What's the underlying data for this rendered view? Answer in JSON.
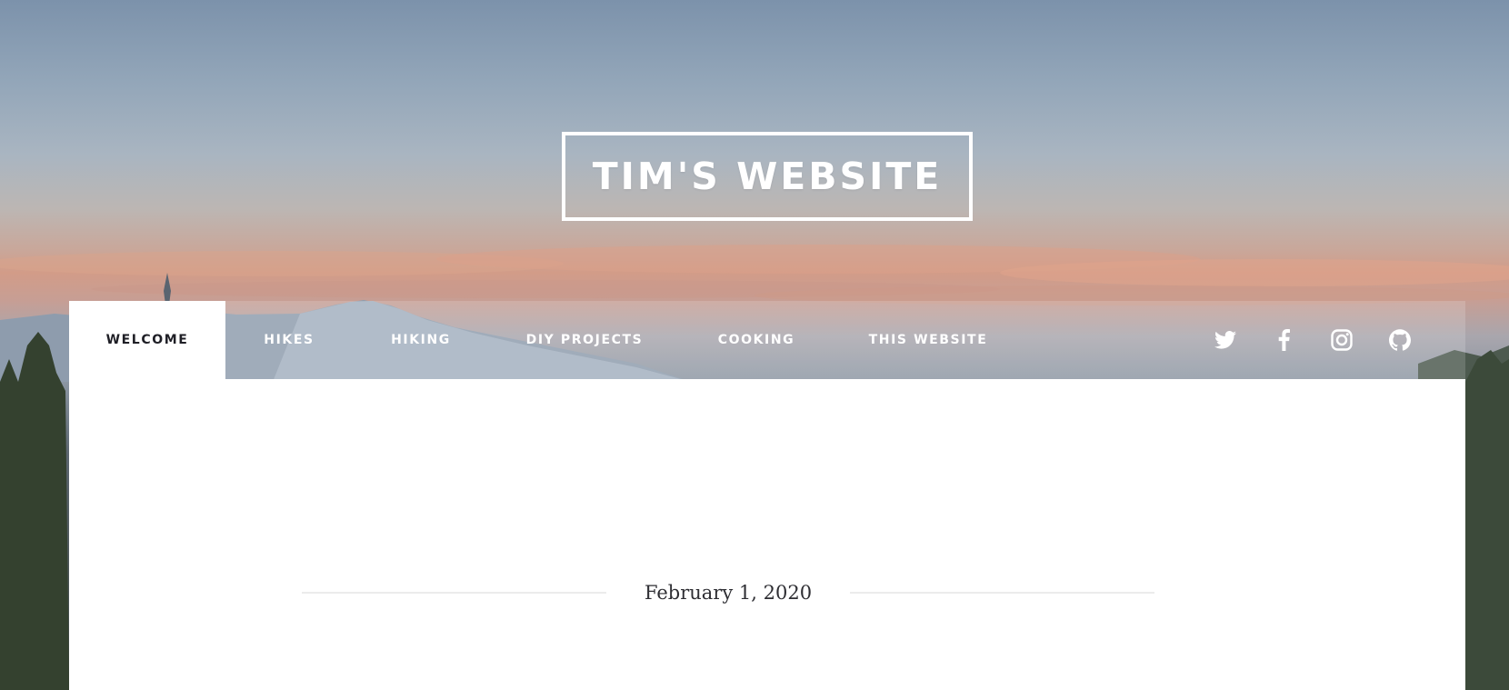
{
  "site": {
    "title": "TIM'S WEBSITE"
  },
  "nav": {
    "items": [
      {
        "label": "WELCOME",
        "active": true
      },
      {
        "label": "HIKES",
        "active": false
      },
      {
        "label": "HIKING",
        "active": false
      },
      {
        "label": "DIY PROJECTS",
        "active": false
      },
      {
        "label": "COOKING",
        "active": false
      },
      {
        "label": "THIS WEBSITE",
        "active": false
      }
    ],
    "social_icons": [
      "twitter-icon",
      "facebook-icon",
      "instagram-icon",
      "github-icon"
    ]
  },
  "post": {
    "date": "February 1, 2020"
  },
  "colors": {
    "nav_text": "#ffffff",
    "active_text": "#1f1f26",
    "content_bg": "#ffffff",
    "date_text": "#2e2e33",
    "divider": "#ececec"
  }
}
